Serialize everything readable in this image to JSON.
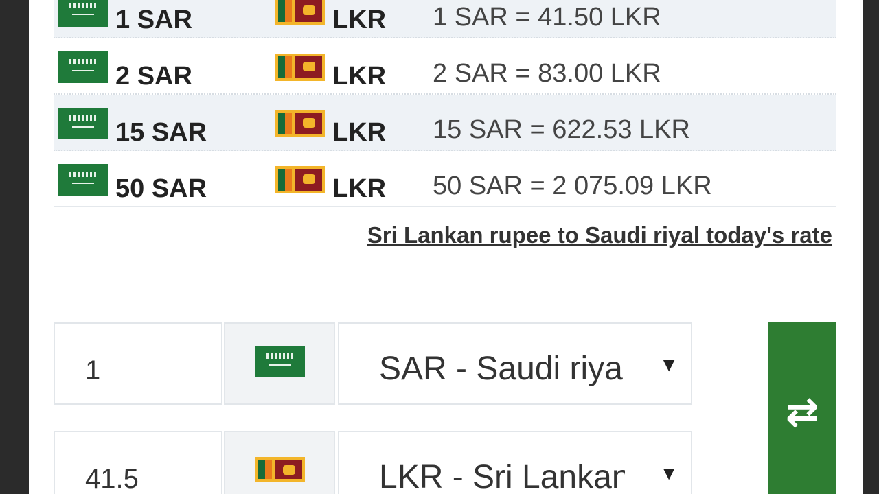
{
  "rates_table": {
    "rows": [
      {
        "amount": "1 SAR",
        "target": "LKR",
        "result": "1 SAR = 41.50 LKR"
      },
      {
        "amount": "2 SAR",
        "target": "LKR",
        "result": "2 SAR = 83.00 LKR"
      },
      {
        "amount": "15 SAR",
        "target": "LKR",
        "result": "15 SAR = 622.53 LKR"
      },
      {
        "amount": "50 SAR",
        "target": "LKR",
        "result": "50 SAR = 2 075.09 LKR"
      }
    ]
  },
  "reverse_link": "Sri Lankan rupee to Saudi riyal today's rate",
  "converter": {
    "from": {
      "amount": "1",
      "currency_label": "SAR - Saudi riyal"
    },
    "to": {
      "amount": "41.5",
      "currency_label": "LKR - Sri Lankan rupee"
    },
    "swap_icon": "⇄"
  },
  "colors": {
    "swap_button": "#2e7d32",
    "saudi_green": "#1f7a3a"
  }
}
